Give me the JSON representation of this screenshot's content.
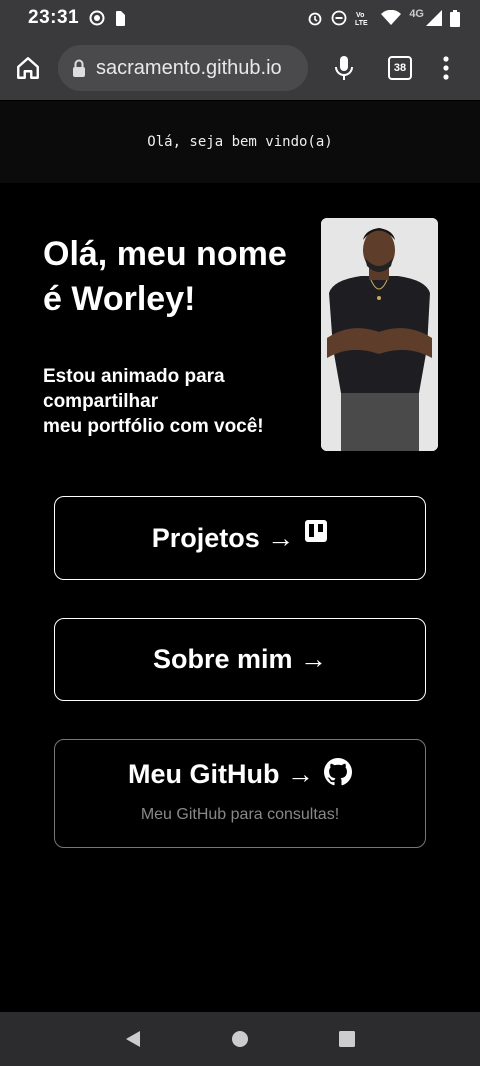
{
  "status_bar": {
    "time": "23:31",
    "network": "4G"
  },
  "browser": {
    "url": "sacramento.github.io",
    "tab_count": "38",
    "load_progress": 0.2
  },
  "page": {
    "greeting": "Olá, seja bem vindo(a)",
    "hero_title": "Olá, meu nome é Worley!",
    "hero_subtitle_lines": [
      "Estou animado para",
      "compartilhar",
      "meu portfólio com você!"
    ],
    "buttons": [
      {
        "label": "Projetos →",
        "icon": "trello-icon"
      },
      {
        "label": "Sobre mim →"
      },
      {
        "label": "Meu GitHub →",
        "icon": "github-icon",
        "description": "Meu GitHub para consultas!"
      }
    ]
  },
  "colors": {
    "background": "#000000",
    "chrome": "#3a3a3c",
    "progress": "#8ab4f8"
  }
}
